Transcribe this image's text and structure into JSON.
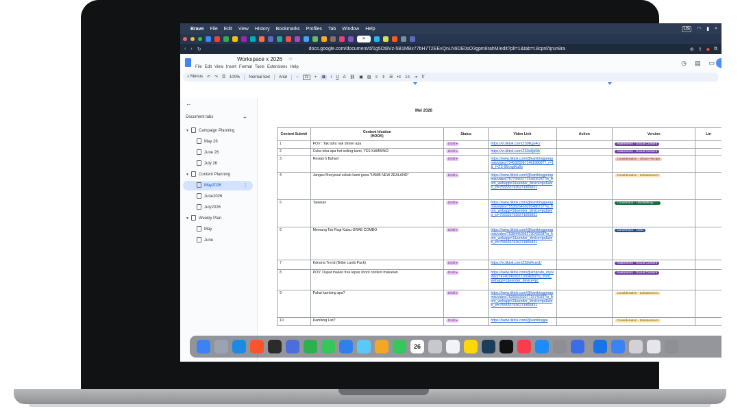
{
  "mac_menu": {
    "app_name": "Brave",
    "items": [
      "File",
      "Edit",
      "View",
      "History",
      "Bookmarks",
      "Profiles",
      "Tab",
      "Window",
      "Help"
    ],
    "right_status": [
      "US"
    ]
  },
  "address_bar": {
    "url": "docs.google.com/document/d/1g5Ot8Vz-5B1MBx77bH7T2EEvQnLN9DE0sO3gpm8rahM/edit?pli=1&tab=t.8cpnl/qrun8ra"
  },
  "document": {
    "title": "Workspace x 2026",
    "menus": [
      "File",
      "Edit",
      "View",
      "Insert",
      "Format",
      "Tools",
      "Extensions",
      "Help"
    ]
  },
  "toolbar": {
    "menus_label": "Menus",
    "zoom": "100%",
    "style": "Normal text",
    "font": "Arial",
    "font_size": "11"
  },
  "sidebar": {
    "header": "Document tabs",
    "add": "+",
    "back": "←",
    "tabs": [
      {
        "label": "Campaign Planning"
      },
      {
        "label": "May 26"
      },
      {
        "label": "June 26"
      },
      {
        "label": "July 26"
      },
      {
        "label": "Content Planning"
      },
      {
        "label": "May2026"
      },
      {
        "label": "June2026"
      },
      {
        "label": "July2026"
      },
      {
        "label": "Weekly Plan"
      },
      {
        "label": "May"
      },
      {
        "label": "June"
      }
    ]
  },
  "sheet": {
    "title": "Mei 2026",
    "headers": [
      "Content Submit",
      "Content Ideation\n(HOOK)",
      "Status",
      "Video Link",
      "Action",
      "Version",
      "Lin"
    ],
    "rows": [
      {
        "no": "1",
        "idea": "POV : Tak tahu nak dinner apa",
        "status": "Draft",
        "link": "https://vt.tiktok.com/ZS9fkgn4c/",
        "version": "Awareness - Social Content",
        "vcolor": "#6b3fa0",
        "vtext": "#ffffff"
      },
      {
        "no": "2",
        "idea": "Cuba teka apa hot selling kami, YES KAMBING!",
        "status": "Draft",
        "link": "https://vt.tiktok.com/ZS9x8jb58/",
        "version": "Awareness - Social Content",
        "vcolor": "#6b3fa0",
        "vtext": "#ffffff"
      },
      {
        "no": "3",
        "idea": "Resepi 5 Bahan!",
        "status": "Draft",
        "link": "https://www.tiktok.com/@kambingperapmis/video/7340328367146198097?_r=1&_t=ZS-95xngiKu8o",
        "version": "Consideration - Share Recipe",
        "vcolor": "#f6c9c6",
        "vtext": "#8a1c14"
      },
      {
        "no": "4",
        "idea": "Jangan Menyesal sebab kami guna \"LAMB NEW ZEALAND\"",
        "status": "Draft",
        "link": "https://www.tiktok.com/@kambingperapmis/video/7577344377194606287?is_from_webapp=1&sender_device=pc&web_id=7555337936271865831",
        "version": "Consideration - Edutainment",
        "vcolor": "#fce8b2",
        "vtext": "#7a5200"
      },
      {
        "no": "5",
        "idea": "Tawaran",
        "status": "Draft",
        "link": "https://www.tiktok.com/@kambingperapmis/video/7553626465095486737?is_from_webapp=1&sender_device=pc&web_id=7555337936271865831",
        "version": "Conversion - Hardselling / ...",
        "vcolor": "#0b6b3a",
        "vtext": "#ffffff"
      },
      {
        "no": "6",
        "idea": "Memang Tak Rugi Kalau GRAB COMBO",
        "status": "Draft",
        "link": "https://www.tiktok.com/@kambingperapmis/video/7538445395273043208?is_from_webapp=1&sender_device=pc&web_id=7555337936271865831",
        "version": "Conversion - UGC",
        "vcolor": "#1f4e9c",
        "vtext": "#ffffff"
      },
      {
        "no": "7",
        "idea": "Kdrama Trend (Bribe Lamb Pack)",
        "status": "Draft",
        "link": "https://vt.tiktok.com/ZS9sRcrw1/",
        "version": "Awareness - Social Content",
        "vcolor": "#6b3fa0",
        "vtext": "#ffffff"
      },
      {
        "no": "8",
        "idea": "POV: Dapat makan free lepas shoot content makanan",
        "status": "Draft",
        "link": "https://www.tiktok.com/@ampcafe_my/video/7474074990221004050?is_from_webapp=1&sender_device=pc",
        "version": "Awareness - Social Content",
        "vcolor": "#6b3fa0",
        "vtext": "#ffffff"
      },
      {
        "no": "9",
        "idea": "Pakai kambing apa?",
        "status": "Draft",
        "link": "https://www.tiktok.com/@kambingperapmis/video/7626550330771574036?is_from_webapp=1&sender_device=pc&web_id=7555337936271865831",
        "version": "Consideration - Edutainment",
        "vcolor": "#fce8b2",
        "vtext": "#7a5200"
      },
      {
        "no": "10",
        "idea": "Kambing List?",
        "status": "Draft",
        "link": "https://www.tiktok.com/@kambingpe",
        "version": "Consideration - Edutainment",
        "vcolor": "#fce8b2",
        "vtext": "#7a5200"
      }
    ]
  },
  "dock": {
    "calendar_day": "26"
  },
  "colors": {
    "menubar_bg": "#2d3b54",
    "status_chip": "#e8c7f3",
    "link": "#1155cc",
    "accent": "#4285f4"
  }
}
